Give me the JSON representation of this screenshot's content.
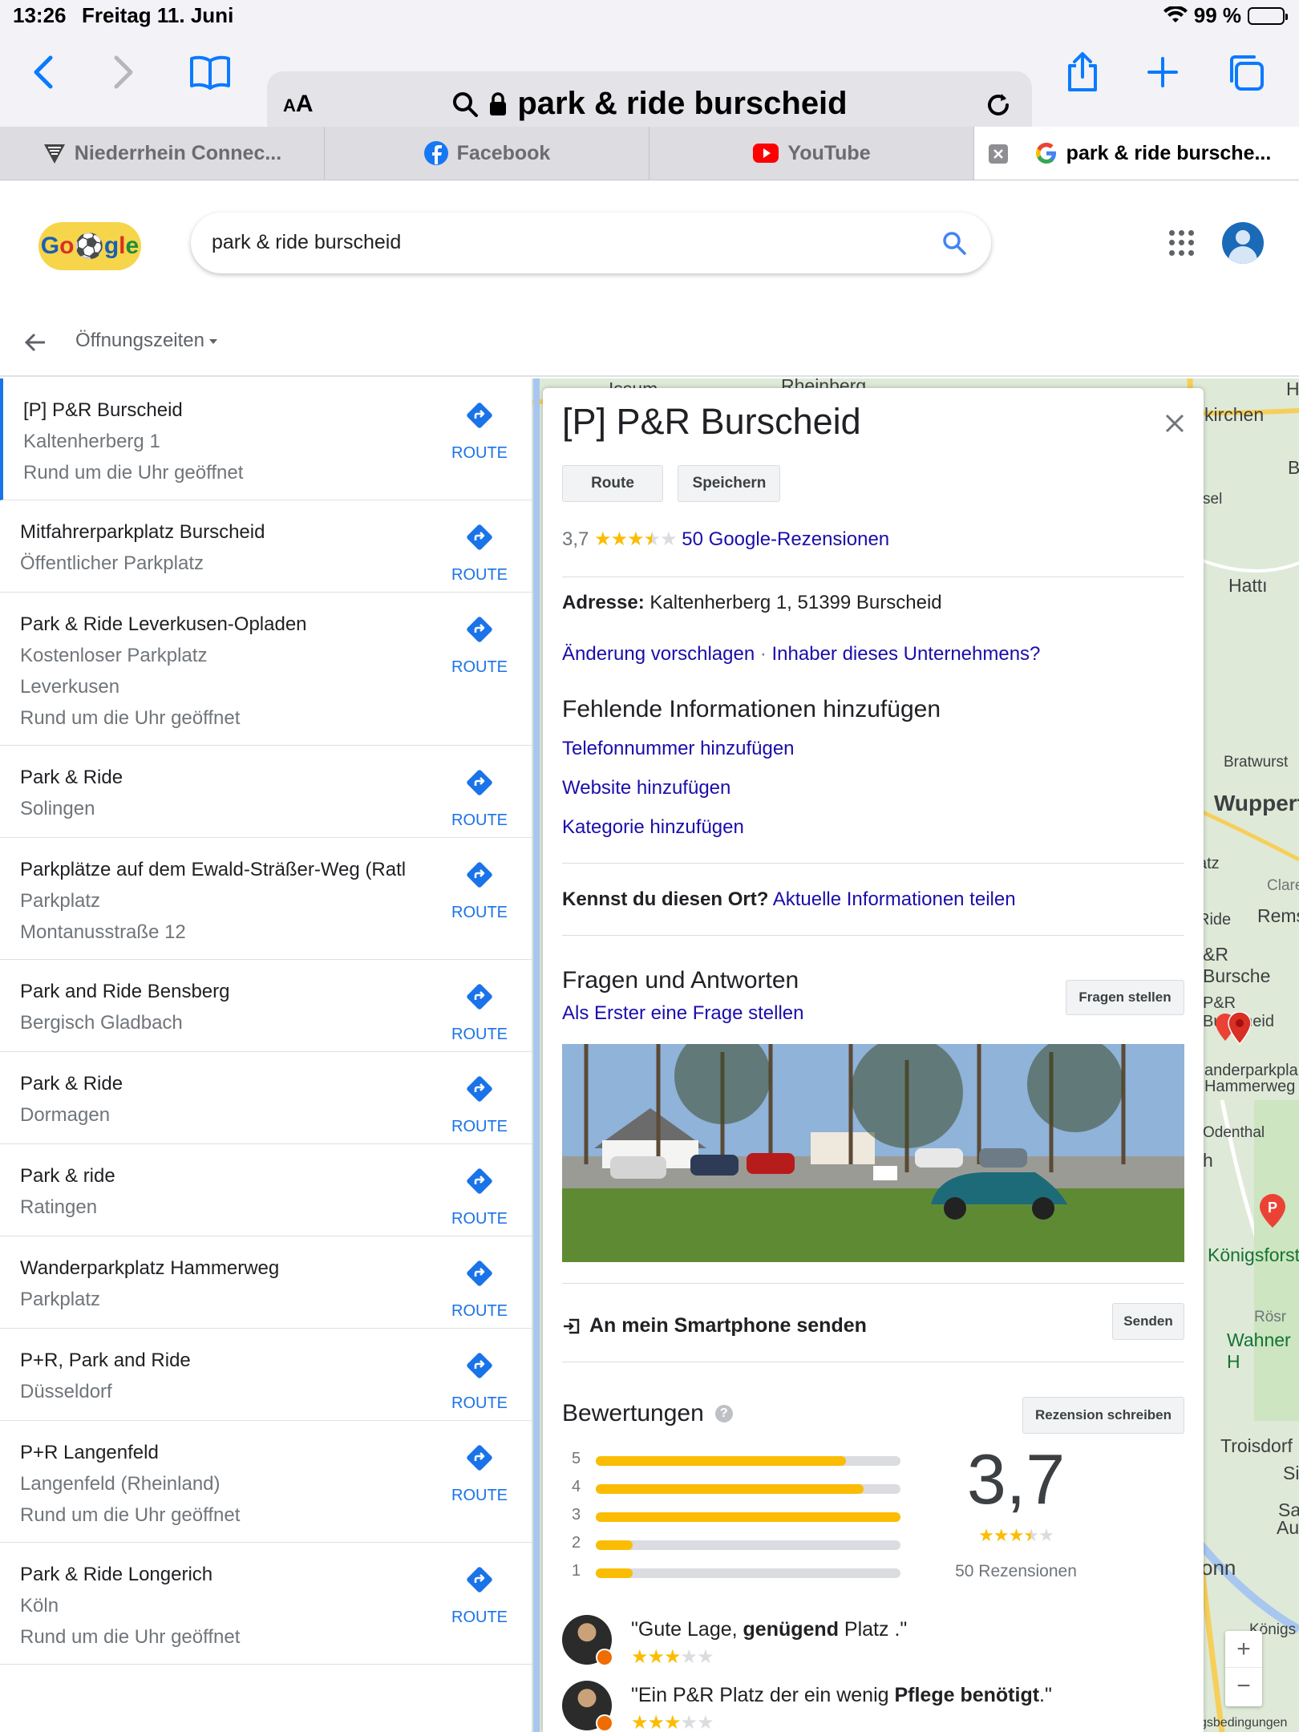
{
  "status": {
    "time": "13:26",
    "date": "Freitag 11. Juni",
    "battery": "99 %"
  },
  "browser": {
    "aa_label": "AA",
    "url_text": "park & ride burscheid",
    "tabs": [
      {
        "label": "Niederrhein Connec..."
      },
      {
        "label": "Facebook"
      },
      {
        "label": "YouTube"
      },
      {
        "label": "park & ride bursche..."
      }
    ]
  },
  "google": {
    "search_query": "park & ride burscheid",
    "filter_label": "Öffnungszeiten"
  },
  "results": [
    {
      "name": "[P] P&R Burscheid",
      "lines": [
        "Kaltenherberg 1",
        "Rund um die Uhr geöffnet"
      ],
      "route": "ROUTE"
    },
    {
      "name": "Mitfahrerparkplatz Burscheid",
      "lines": [
        "Öffentlicher Parkplatz"
      ],
      "route": "ROUTE"
    },
    {
      "name": "Park & Ride Leverkusen-Opladen",
      "lines": [
        "Kostenloser Parkplatz",
        "Leverkusen",
        "Rund um die Uhr geöffnet"
      ],
      "route": "ROUTE"
    },
    {
      "name": "Park & Ride",
      "lines": [
        "Solingen"
      ],
      "route": "ROUTE"
    },
    {
      "name": "Parkplätze auf dem Ewald-Sträßer-Weg (Ratl",
      "lines": [
        "Parkplatz",
        "Montanusstraße 12"
      ],
      "route": "ROUTE"
    },
    {
      "name": "Park and Ride Bensberg",
      "lines": [
        "Bergisch Gladbach"
      ],
      "route": "ROUTE"
    },
    {
      "name": "Park & Ride",
      "lines": [
        "Dormagen"
      ],
      "route": "ROUTE"
    },
    {
      "name": "Park & ride",
      "lines": [
        "Ratingen"
      ],
      "route": "ROUTE"
    },
    {
      "name": "Wanderparkplatz Hammerweg",
      "lines": [
        "Parkplatz"
      ],
      "route": "ROUTE"
    },
    {
      "name": "P+R, Park and Ride",
      "lines": [
        "Düsseldorf"
      ],
      "route": "ROUTE"
    },
    {
      "name": "P+R Langenfeld",
      "lines": [
        "Langenfeld (Rheinland)",
        "Rund um die Uhr geöffnet"
      ],
      "route": "ROUTE"
    },
    {
      "name": "Park & Ride Longerich",
      "lines": [
        "Köln",
        "Rund um die Uhr geöffnet"
      ],
      "route": "ROUTE"
    }
  ],
  "map_labels": [
    "kirchen",
    "Hattı",
    "Bratwurst",
    "Wupperta",
    "atz",
    "Clare",
    "Ride",
    "Rems",
    "&R Bursche",
    "P&R Burscheid",
    "anderparkpla",
    "Hammerweg",
    "Odenthal",
    "Königsforst",
    "Rösr",
    "Wahner H",
    "Troisdorf",
    "Sie",
    "Sar",
    "Augu",
    "onn",
    "Königs",
    "gsbedingungen",
    "Issum",
    "Rheinberg",
    "B",
    "H",
    "sel",
    "h"
  ],
  "map_controls": {
    "zoom_in": "+",
    "zoom_out": "−"
  },
  "place": {
    "title": "[P] P&R Burscheid",
    "route_button": "Route",
    "save_button": "Speichern",
    "rating": "3,7",
    "rating_value": 3.7,
    "reviews_link": "50 Google-Rezensionen",
    "address_label": "Adresse:",
    "address": "Kaltenherberg 1, 51399 Burscheid",
    "suggest_edit": "Änderung vorschlagen",
    "owner_link": "Inhaber dieses Unternehmens?",
    "missing_info_title": "Fehlende Informationen hinzufügen",
    "add_phone": "Telefonnummer hinzufügen",
    "add_website": "Website hinzufügen",
    "add_category": "Kategorie hinzufügen",
    "know_place": "Kennst du diesen Ort?",
    "share_info": "Aktuelle Informationen teilen",
    "qa_title": "Fragen und Antworten",
    "qa_first": "Als Erster eine Frage stellen",
    "ask_button": "Fragen stellen",
    "send_phone": "An mein Smartphone senden",
    "send_button": "Senden",
    "reviews_title": "Bewertungen",
    "write_review": "Rezension schreiben",
    "rating_big": "3,7",
    "reviews_count": "50 Rezensionen",
    "rating_bars": [
      {
        "label": "5",
        "fraction": 0.82
      },
      {
        "label": "4",
        "fraction": 0.88
      },
      {
        "label": "3",
        "fraction": 1.0
      },
      {
        "label": "2",
        "fraction": 0.12
      },
      {
        "label": "1",
        "fraction": 0.12
      }
    ],
    "review_snippets": [
      {
        "pre": "\"Gute Lage, ",
        "bold": "genügend",
        "post": " Platz .\"",
        "stars": 3
      },
      {
        "pre": "\"Ein P&R Platz der ein wenig ",
        "bold": "Pflege benötigt",
        "post": ".\"",
        "stars": 3
      }
    ]
  },
  "colors": {
    "accent": "#1a73e8",
    "link": "#1a0dab",
    "star": "#fbbc04",
    "ios_blue": "#0a7aff"
  }
}
